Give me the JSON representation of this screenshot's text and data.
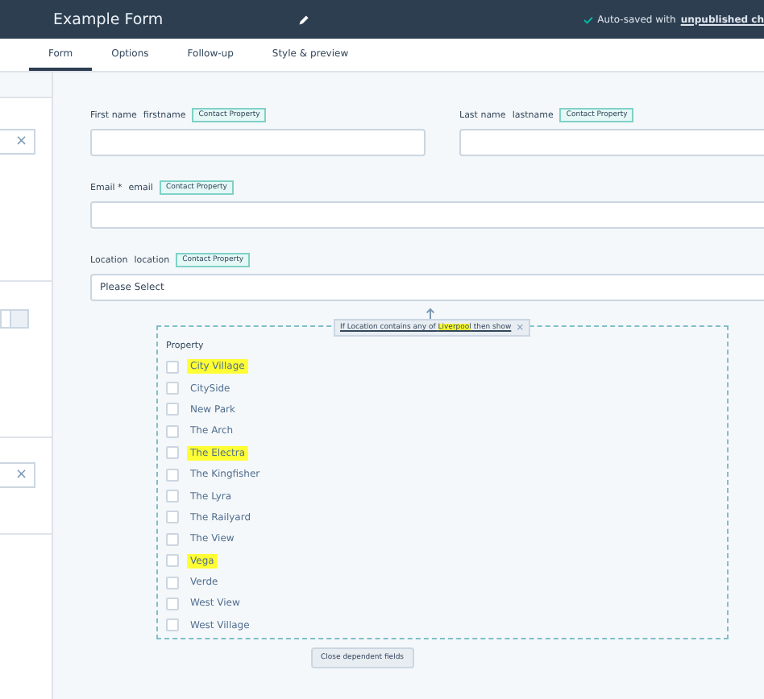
{
  "header": {
    "title": "Example Form",
    "status": "Auto-saved with ",
    "status_link": "unpublished ch"
  },
  "tabs": [
    {
      "label": "Form",
      "selected": true
    },
    {
      "label": "Options",
      "selected": false
    },
    {
      "label": "Follow-up",
      "selected": false
    },
    {
      "label": "Style & preview",
      "selected": false
    }
  ],
  "sidebar": {
    "clear_buttons": [
      "×",
      "×"
    ]
  },
  "field_rows": [
    [
      {
        "label": "First name",
        "internal": "firstname",
        "badge": "Contact Property",
        "kind": "text"
      },
      {
        "label": "Last name",
        "internal": "lastname",
        "badge": "Contact Property",
        "kind": "text"
      }
    ],
    [
      {
        "label": "Email",
        "required_mark": "*",
        "internal": "email",
        "badge": "Contact Property",
        "kind": "text"
      }
    ],
    [
      {
        "label": "Location",
        "internal": "location",
        "badge": "Contact Property",
        "kind": "select",
        "placeholder": "Please Select"
      }
    ]
  ],
  "dependent": {
    "condition": {
      "before": "If Location contains any of ",
      "highlight": "Liverpool",
      "after": " then show",
      "close": "×"
    },
    "label": "Property",
    "options": [
      {
        "label": "City Village",
        "highlighted": true,
        "checked": false
      },
      {
        "label": "CitySide",
        "highlighted": false,
        "checked": false
      },
      {
        "label": "New Park",
        "highlighted": false,
        "checked": false
      },
      {
        "label": "The Arch",
        "highlighted": false,
        "checked": false
      },
      {
        "label": "The Electra",
        "highlighted": true,
        "checked": false
      },
      {
        "label": "The Kingfisher",
        "highlighted": false,
        "checked": false
      },
      {
        "label": "The Lyra",
        "highlighted": false,
        "checked": false
      },
      {
        "label": "The Railyard",
        "highlighted": false,
        "checked": false
      },
      {
        "label": "The View",
        "highlighted": false,
        "checked": false
      },
      {
        "label": "Vega",
        "highlighted": true,
        "checked": false
      },
      {
        "label": "Verde",
        "highlighted": false,
        "checked": false
      },
      {
        "label": "West View",
        "highlighted": false,
        "checked": false
      },
      {
        "label": "West Village",
        "highlighted": false,
        "checked": false
      }
    ],
    "close_button": "Close dependent fields"
  }
}
